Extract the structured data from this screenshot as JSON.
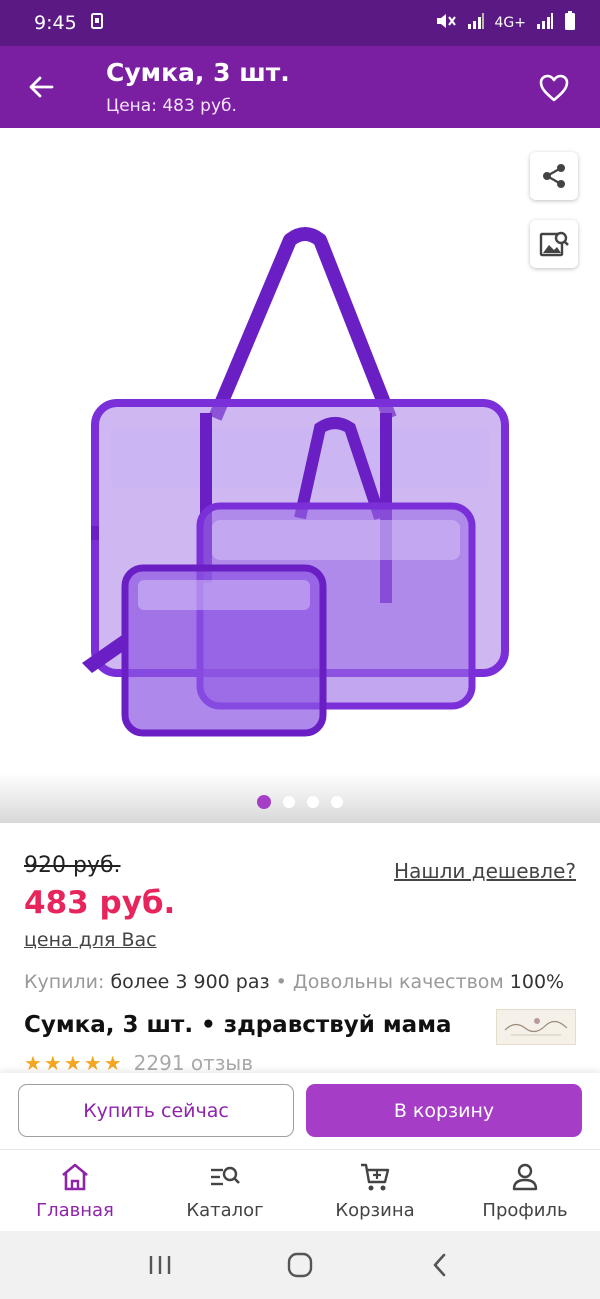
{
  "status_bar": {
    "time": "9:45",
    "network": "4G+"
  },
  "app_bar": {
    "title": "Сумка, 3 шт.",
    "subtitle": "Цена: 483 руб."
  },
  "gallery": {
    "image_count": 4,
    "active_index": 0
  },
  "product": {
    "old_price": "920 руб.",
    "price": "483 руб.",
    "price_note": "цена для Вас",
    "cheaper_link": "Нашли дешевле?",
    "stats_bought_label": "Купили:",
    "stats_bought_value": "более 3 900 раз",
    "stats_separator": "•",
    "stats_quality_label": "Довольны качеством",
    "stats_quality_value": "100%",
    "name": "Сумка, 3 шт. • здравствуй мама",
    "rating": 5,
    "reviews": "2291 отзыв"
  },
  "actions": {
    "buy_now": "Купить сейчас",
    "add_to_cart": "В корзину"
  },
  "bottom_nav": [
    {
      "label": "Главная",
      "icon": "home-icon",
      "active": true
    },
    {
      "label": "Каталог",
      "icon": "catalog-search-icon",
      "active": false
    },
    {
      "label": "Корзина",
      "icon": "cart-icon",
      "active": false
    },
    {
      "label": "Профиль",
      "icon": "profile-icon",
      "active": false
    }
  ],
  "colors": {
    "status": "#5b1a83",
    "appbar": "#7b1fa2",
    "accent": "#a63dc7",
    "price": "#e8245c",
    "stars": "#f5a623"
  }
}
